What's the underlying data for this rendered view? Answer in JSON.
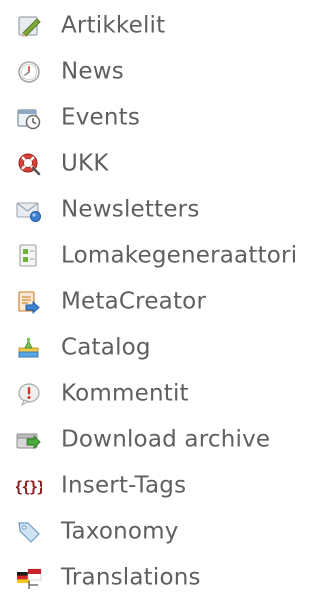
{
  "menu": {
    "items": [
      {
        "label": "Artikkelit",
        "icon": "article-pencil-icon"
      },
      {
        "label": "News",
        "icon": "news-clock-icon"
      },
      {
        "label": "Events",
        "icon": "events-calendar-icon"
      },
      {
        "label": "UKK",
        "icon": "faq-lifebuoy-icon"
      },
      {
        "label": "Newsletters",
        "icon": "newsletter-envelope-icon"
      },
      {
        "label": "Lomakegeneraattori",
        "icon": "form-generator-icon"
      },
      {
        "label": "MetaCreator",
        "icon": "metacreator-icon"
      },
      {
        "label": "Catalog",
        "icon": "catalog-icon"
      },
      {
        "label": "Kommentit",
        "icon": "comments-icon"
      },
      {
        "label": "Download archive",
        "icon": "download-archive-icon"
      },
      {
        "label": "Insert-Tags",
        "icon": "insert-tags-icon"
      },
      {
        "label": "Taxonomy",
        "icon": "taxonomy-tag-icon"
      },
      {
        "label": "Translations",
        "icon": "translations-icon"
      }
    ]
  }
}
